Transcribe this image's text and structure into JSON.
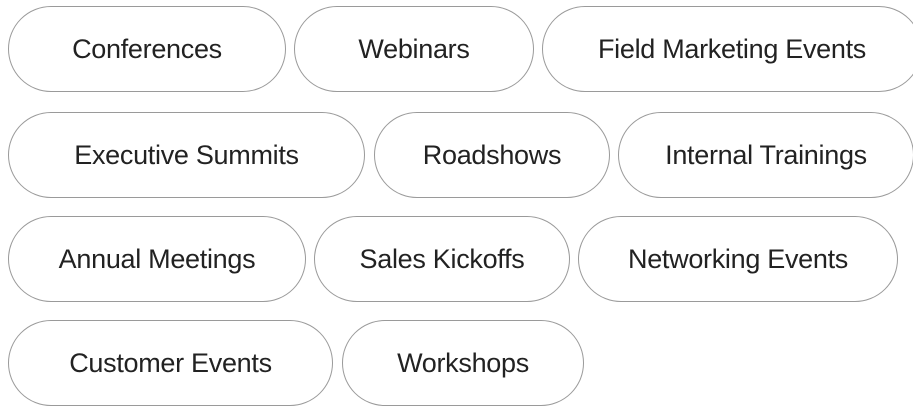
{
  "tags": [
    {
      "label": "Conferences"
    },
    {
      "label": "Webinars"
    },
    {
      "label": "Field Marketing Events"
    },
    {
      "label": "Executive Summits"
    },
    {
      "label": "Roadshows"
    },
    {
      "label": "Internal Trainings"
    },
    {
      "label": "Annual Meetings"
    },
    {
      "label": "Sales Kickoffs"
    },
    {
      "label": "Networking Events"
    },
    {
      "label": "Customer Events"
    },
    {
      "label": "Workshops"
    }
  ]
}
